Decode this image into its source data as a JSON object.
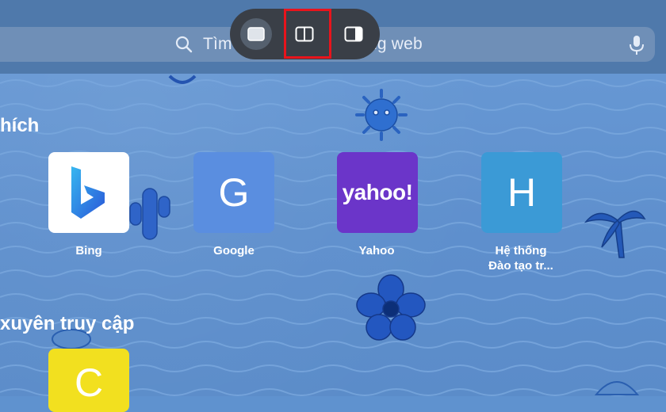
{
  "browser": {
    "search_placeholder": "Tìm kiếm hoặc nhập tên trang web",
    "search_placeholder_visible": "Tìm",
    "search_placeholder_tail": "ng web"
  },
  "layout_switcher": {
    "options": [
      "full-screen-icon",
      "split-view-icon",
      "side-panel-icon"
    ],
    "highlighted": "split-view-icon",
    "highlight_color": "#e8141c"
  },
  "favorites": {
    "title": "hích",
    "items": [
      {
        "label": "Bing",
        "glyph": "b",
        "bg": "#ffffff"
      },
      {
        "label": "Google",
        "glyph": "G",
        "bg": "#5a8ee0"
      },
      {
        "label": "Yahoo",
        "glyph": "yahoo!",
        "bg": "#6b35c9"
      },
      {
        "label_line1": "Hệ thống",
        "label_line2": "Đào tạo tr...",
        "glyph": "H",
        "bg": "#3b9ad6"
      }
    ]
  },
  "frequent": {
    "title": "xuyên truy cập",
    "items": [
      {
        "glyph": "C",
        "bg": "#f2e01f"
      }
    ]
  }
}
